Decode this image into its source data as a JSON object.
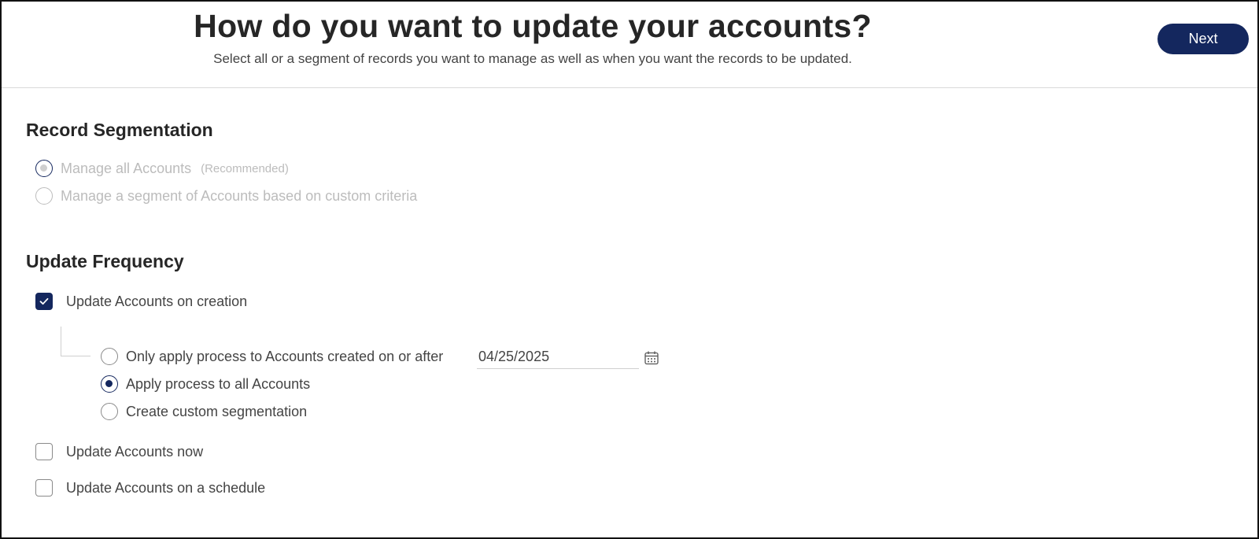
{
  "header": {
    "title": "How do you want to update your accounts?",
    "subtitle": "Select all or a segment of records you want to manage as well as when you want the records to be updated.",
    "next_label": "Next"
  },
  "segmentation": {
    "title": "Record Segmentation",
    "options": [
      {
        "label": "Manage all Accounts",
        "hint": "(Recommended)",
        "selected": true,
        "disabled": true
      },
      {
        "label": "Manage a segment of Accounts based on custom criteria",
        "selected": false,
        "disabled": true
      }
    ]
  },
  "frequency": {
    "title": "Update Frequency",
    "on_creation": {
      "label": "Update Accounts on creation",
      "checked": true,
      "sub_options": [
        {
          "label": "Only apply process to Accounts created on or after",
          "selected": false
        },
        {
          "label": "Apply process to all Accounts",
          "selected": true
        },
        {
          "label": "Create custom segmentation",
          "selected": false
        }
      ],
      "date_value": "04/25/2025"
    },
    "now": {
      "label": "Update Accounts now",
      "checked": false
    },
    "schedule": {
      "label": "Update Accounts on a schedule",
      "checked": false
    }
  },
  "colors": {
    "accent": "#14275e",
    "disabled_text": "#bcbcbc",
    "text": "#444444"
  },
  "icons": {
    "calendar": "calendar-icon",
    "check": "check-icon"
  }
}
